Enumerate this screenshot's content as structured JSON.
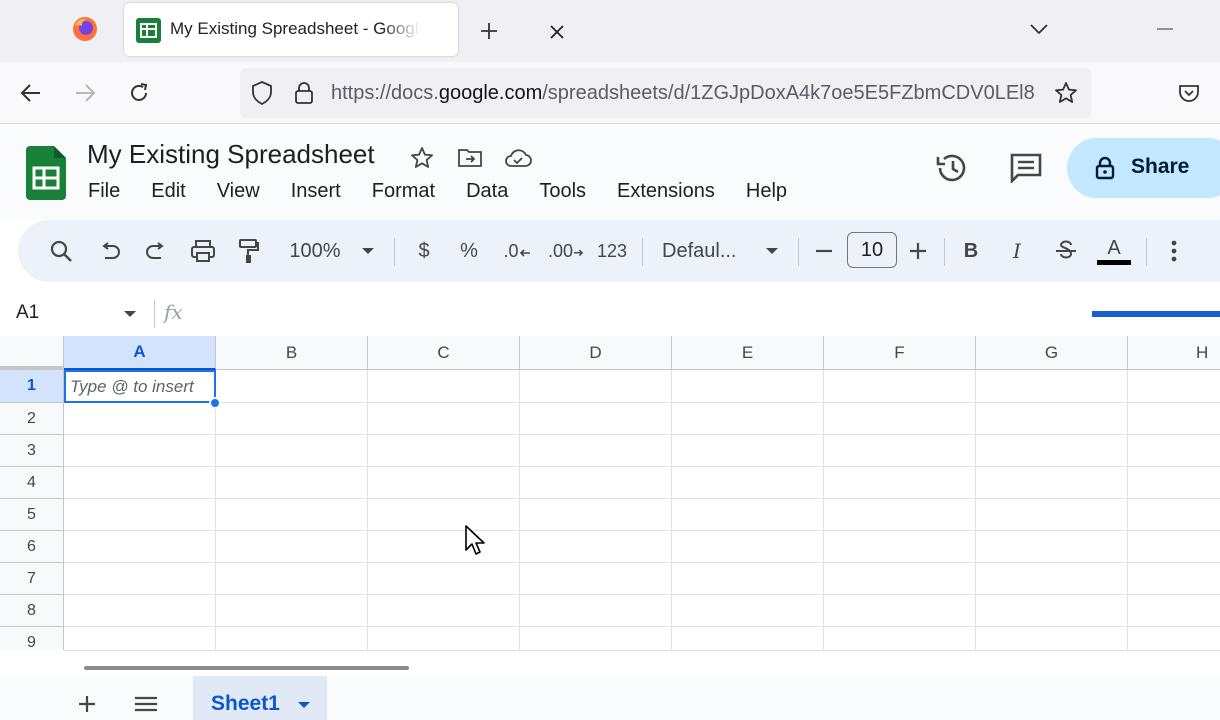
{
  "browser": {
    "tab": {
      "title": "My Existing Spreadsheet - Google Sheets"
    },
    "url": {
      "prefix": "https://docs.",
      "domain": "google.com",
      "path": "/spreadsheets/d/1ZGJpDoxA4k7oe5E5FZbmCDV0LEl8"
    }
  },
  "doc": {
    "title": "My Existing Spreadsheet",
    "menu": [
      "File",
      "Edit",
      "View",
      "Insert",
      "Format",
      "Data",
      "Tools",
      "Extensions",
      "Help"
    ],
    "share_label": "Share"
  },
  "toolbar": {
    "zoom": "100%",
    "currency": "$",
    "percent": "%",
    "decrease_decimal": ".0",
    "increase_decimal": ".00",
    "number_format": "123",
    "font": "Defaul...",
    "font_size": "10",
    "bold": "B",
    "italic": "I",
    "text_color": "A"
  },
  "formula_bar": {
    "name_box": "A1",
    "fx": "fx"
  },
  "grid": {
    "columns": [
      "A",
      "B",
      "C",
      "D",
      "E",
      "F",
      "G",
      "H"
    ],
    "rows": [
      "1",
      "2",
      "3",
      "4",
      "5",
      "6",
      "7",
      "8",
      "9"
    ],
    "active_cell_hint": "Type @ to insert"
  },
  "sheets": {
    "active": "Sheet1"
  },
  "colors": {
    "accent": "#0b57d0",
    "sheets_green": "#188038",
    "share_bg": "#c2e7ff"
  }
}
